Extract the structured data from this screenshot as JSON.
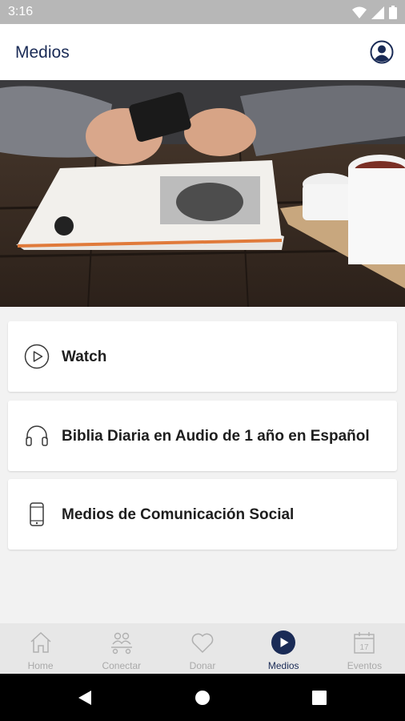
{
  "status_bar": {
    "time": "3:16"
  },
  "app_bar": {
    "title": "Medios"
  },
  "menu": [
    {
      "label": "Watch",
      "icon": "play-circle-icon"
    },
    {
      "label": "Biblia Diaria en Audio de 1 año en Español",
      "icon": "headphones-icon"
    },
    {
      "label": "Medios de Comunicación Social",
      "icon": "smartphone-icon"
    }
  ],
  "bottom_nav": [
    {
      "label": "Home",
      "icon": "home-icon",
      "active": false
    },
    {
      "label": "Conectar",
      "icon": "people-icon",
      "active": false
    },
    {
      "label": "Donar",
      "icon": "heart-icon",
      "active": false
    },
    {
      "label": "Medios",
      "icon": "play-circle-filled-icon",
      "active": true
    },
    {
      "label": "Eventos",
      "icon": "calendar-icon",
      "active": false,
      "calendar_day": "17"
    }
  ],
  "colors": {
    "primary": "#1a2b56",
    "inactive": "#a9a9a9",
    "status_bar": "#b7b7b7"
  }
}
